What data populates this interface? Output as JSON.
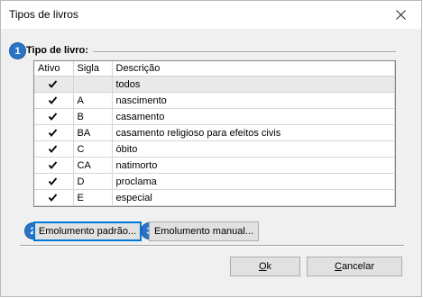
{
  "window": {
    "title": "Tipos de livros"
  },
  "group": {
    "label": "Tipo de livro:",
    "marker": "1"
  },
  "table": {
    "columns": [
      "Ativo",
      "Sigla",
      "Descrição"
    ],
    "rows": [
      {
        "active": true,
        "sigla": "",
        "descricao": "todos"
      },
      {
        "active": true,
        "sigla": "A",
        "descricao": "nascimento"
      },
      {
        "active": true,
        "sigla": "B",
        "descricao": "casamento"
      },
      {
        "active": true,
        "sigla": "BA",
        "descricao": "casamento religioso para efeitos civis"
      },
      {
        "active": true,
        "sigla": "C",
        "descricao": "óbito"
      },
      {
        "active": true,
        "sigla": "CA",
        "descricao": "natimorto"
      },
      {
        "active": true,
        "sigla": "D",
        "descricao": "proclama"
      },
      {
        "active": true,
        "sigla": "E",
        "descricao": "especial"
      }
    ]
  },
  "buttons": {
    "emolumento_padrao": "Emolumento padrão...",
    "emolumento_padrao_marker": "2",
    "emolumento_manual": "Emolumento manual...",
    "emolumento_manual_marker": "3",
    "ok_accel": "O",
    "ok_rest": "k",
    "cancelar_accel": "C",
    "cancelar_rest": "ancelar"
  },
  "colors": {
    "marker": "#2a74c8",
    "default_button_border": "#0078d7"
  }
}
